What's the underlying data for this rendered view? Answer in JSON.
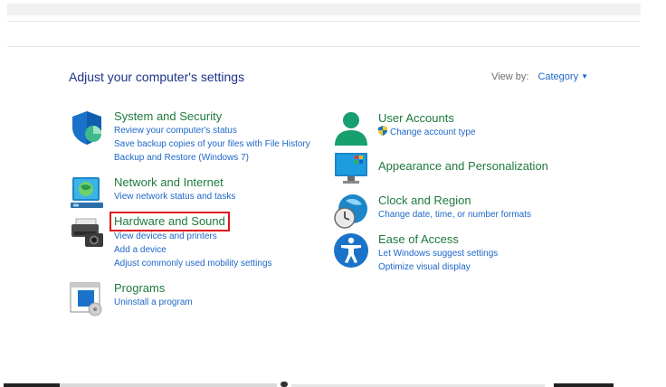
{
  "header": {
    "title": "Adjust your computer's settings",
    "view_by_label": "View by:",
    "view_by_value": "Category"
  },
  "categories": [
    {
      "title": "System and Security",
      "icon": "shield-icon",
      "links": [
        "Review your computer's status",
        "Save backup copies of your files with File History",
        "Backup and Restore (Windows 7)"
      ]
    },
    {
      "title": "Network and Internet",
      "icon": "globe-network-icon",
      "links": [
        "View network status and tasks"
      ]
    },
    {
      "title": "Hardware and Sound",
      "icon": "printer-camera-icon",
      "highlighted": true,
      "links": [
        "View devices and printers",
        "Add a device",
        "Adjust commonly used mobility settings"
      ]
    },
    {
      "title": "Programs",
      "icon": "programs-icon",
      "links": [
        "Uninstall a program"
      ]
    },
    {
      "title": "User Accounts",
      "icon": "user-icon",
      "links": [
        "Change account type"
      ]
    },
    {
      "title": "Appearance and Personalization",
      "icon": "monitor-icon",
      "links": []
    },
    {
      "title": "Clock and Region",
      "icon": "clock-globe-icon",
      "links": [
        "Change date, time, or number formats"
      ]
    },
    {
      "title": "Ease of Access",
      "icon": "accessibility-icon",
      "links": [
        "Let Windows suggest settings",
        "Optimize visual display"
      ]
    }
  ],
  "colors": {
    "heading": "#1e3287",
    "category_title": "#1f7a3d",
    "link": "#1e67c8",
    "highlight_box": "#e0141b"
  }
}
